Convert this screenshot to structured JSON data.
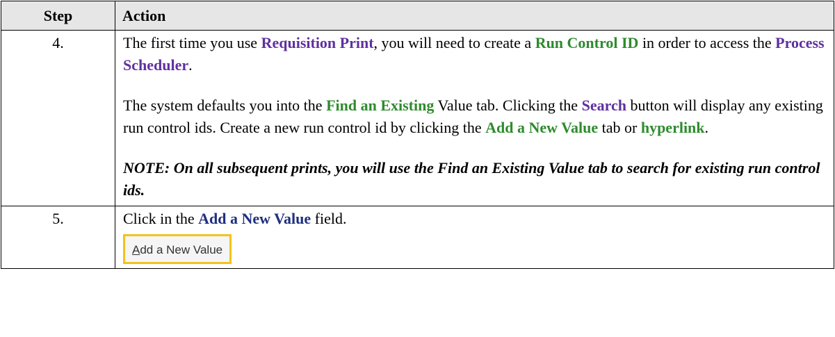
{
  "table": {
    "headers": {
      "step": "Step",
      "action": "Action"
    },
    "rows": [
      {
        "step": "4.",
        "p1": {
          "t1": "The first time you use ",
          "b1": "Requisition Print",
          "t2": ", you will need to create a ",
          "b2": "Run Control ID",
          "t3": " in order to access the ",
          "b3": "Process Scheduler",
          "t4": "."
        },
        "p2": {
          "t1": "The system defaults you into the ",
          "b1": "Find an Existing",
          "t2": " Value tab. Clicking the ",
          "b2": "Search",
          "t3": " button will display any existing run control ids. Create a new run control id by clicking the ",
          "b3": "Add a New Value",
          "t4": " tab or ",
          "b4": "hyperlink",
          "t5": "."
        },
        "note": "NOTE: On all subsequent prints, you will use the Find an Existing Value tab to search for existing run control ids."
      },
      {
        "step": "5.",
        "p1": {
          "t1": "Click in the ",
          "b1": "Add a New Value",
          "t2": " field."
        },
        "button": {
          "first_letter": "A",
          "rest": "dd a New Value"
        }
      }
    ]
  },
  "colors": {
    "purple": "#6030a0",
    "green": "#2e8b2e",
    "navy": "#1f2f7f",
    "highlight": "#f5c21a",
    "header_bg": "#e6e6e6"
  }
}
